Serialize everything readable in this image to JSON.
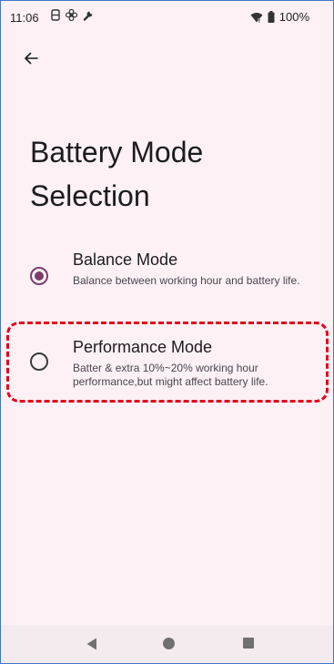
{
  "status_bar": {
    "time": "11:06",
    "battery": "100%",
    "icons": [
      "notification-icon",
      "fan-icon",
      "wrench-icon",
      "wifi-icon",
      "battery-icon"
    ]
  },
  "page": {
    "title": "Battery Mode Selection"
  },
  "options": [
    {
      "title": "Balance Mode",
      "description": "Balance between working hour and battery life.",
      "selected": true
    },
    {
      "title": "Performance Mode",
      "description": "Batter & extra 10%~20% working hour performance,but might affect battery life.",
      "selected": false
    }
  ],
  "colors": {
    "background": "#fdf1f5",
    "accent": "#7c3d6e",
    "highlight": "#e3001b"
  }
}
